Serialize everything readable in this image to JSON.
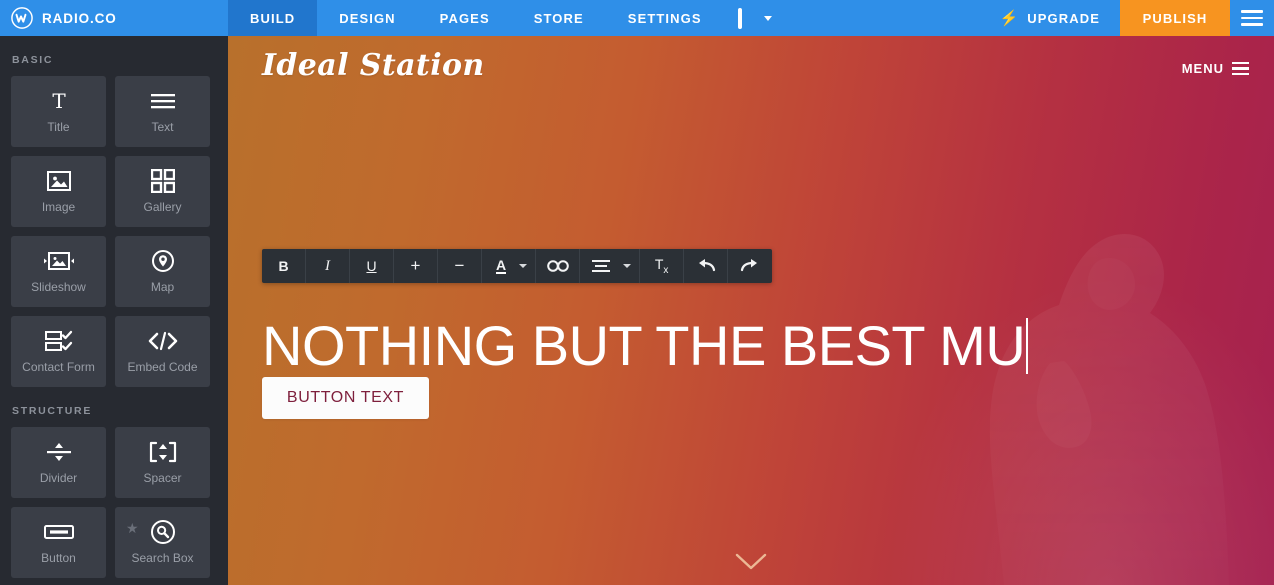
{
  "topnav": {
    "logo_icon": "weebly-w-logo-icon",
    "brand": "RADIO.CO",
    "tabs": [
      {
        "label": "BUILD",
        "active": true
      },
      {
        "label": "DESIGN",
        "active": false
      },
      {
        "label": "PAGES",
        "active": false
      },
      {
        "label": "STORE",
        "active": false
      },
      {
        "label": "SETTINGS",
        "active": false
      }
    ],
    "device_icon": "monitor-icon",
    "device_caret_icon": "chevron-down-icon",
    "upgrade_label": "UPGRADE",
    "upgrade_icon": "bolt-icon",
    "publish_label": "PUBLISH",
    "menu_icon": "hamburger-menu-icon",
    "accent_blue": "#2f8fe8",
    "active_blue": "#2176cd",
    "publish_orange": "#f79420"
  },
  "sidebar": {
    "sections": [
      {
        "title": "BASIC",
        "items": [
          {
            "label": "Title",
            "icon": "title-T-icon"
          },
          {
            "label": "Text",
            "icon": "text-lines-icon"
          },
          {
            "label": "Image",
            "icon": "image-icon"
          },
          {
            "label": "Gallery",
            "icon": "gallery-grid-icon"
          },
          {
            "label": "Slideshow",
            "icon": "slideshow-icon"
          },
          {
            "label": "Map",
            "icon": "map-pin-icon"
          },
          {
            "label": "Contact Form",
            "icon": "contact-form-icon"
          },
          {
            "label": "Embed Code",
            "icon": "embed-code-icon"
          }
        ]
      },
      {
        "title": "STRUCTURE",
        "items": [
          {
            "label": "Divider",
            "icon": "divider-icon"
          },
          {
            "label": "Spacer",
            "icon": "spacer-icon"
          },
          {
            "label": "Button",
            "icon": "button-icon"
          },
          {
            "label": "Search Box",
            "icon": "search-icon",
            "badge": "pro-star-icon"
          }
        ]
      }
    ],
    "bg": "#272a31",
    "card_bg": "#3a3e47"
  },
  "canvas": {
    "site_title": "Ideal Station",
    "site_menu_label": "MENU",
    "site_menu_icon": "hamburger-menu-icon",
    "hero_heading": "NOTHING BUT THE BEST MU",
    "hero_button_label": "BUTTON TEXT",
    "scroll_icon": "chevron-down-icon",
    "gradient_start": "#b8702c",
    "gradient_end": "#a52150",
    "button_text_color": "#7e1f3c"
  },
  "editor_toolbar": {
    "buttons": [
      {
        "label": "B",
        "name": "bold-button",
        "icon": "bold-icon"
      },
      {
        "label": "I",
        "name": "italic-button",
        "icon": "italic-icon"
      },
      {
        "label": "U",
        "name": "underline-button",
        "icon": "underline-icon"
      },
      {
        "label": "+",
        "name": "increase-font-size-button",
        "icon": "plus-icon"
      },
      {
        "label": "−",
        "name": "decrease-font-size-button",
        "icon": "minus-icon"
      },
      {
        "label": "A",
        "name": "text-color-button",
        "icon": "font-color-icon"
      },
      {
        "label": "",
        "name": "text-color-dropdown",
        "icon": "chevron-down-icon"
      },
      {
        "label": "",
        "name": "link-button",
        "icon": "link-chain-icon"
      },
      {
        "label": "",
        "name": "align-button",
        "icon": "align-lines-icon"
      },
      {
        "label": "",
        "name": "align-dropdown",
        "icon": "chevron-down-icon"
      },
      {
        "label": "Tx",
        "name": "clear-formatting-button",
        "icon": "clear-format-icon"
      },
      {
        "label": "",
        "name": "undo-button",
        "icon": "undo-arrow-icon"
      },
      {
        "label": "",
        "name": "redo-button",
        "icon": "redo-arrow-icon"
      }
    ]
  }
}
